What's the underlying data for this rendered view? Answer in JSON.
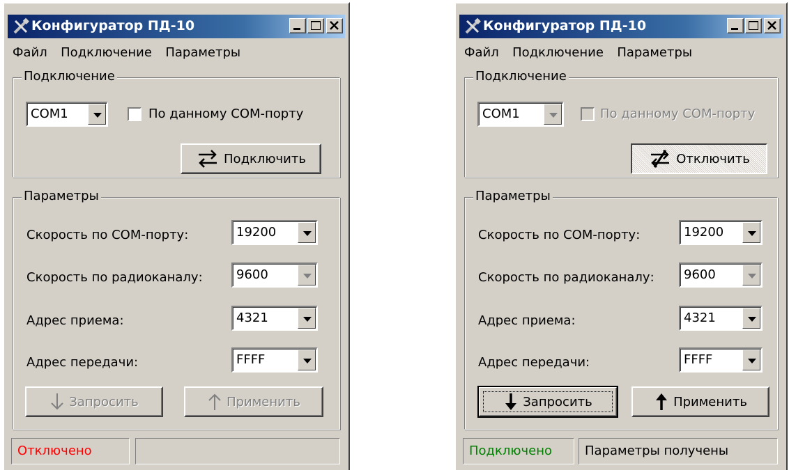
{
  "windows": [
    {
      "title": "Конфигуратор ПД-10",
      "menu": [
        "Файл",
        "Подключение",
        "Параметры"
      ],
      "connection": {
        "group_label": "Подключение",
        "port_value": "COM1",
        "checkbox_label": "По данному COM-порту",
        "button_label": "Подключить"
      },
      "params": {
        "group_label": "Параметры",
        "rows": [
          {
            "label": "Скорость по COM-порту:",
            "value": "19200"
          },
          {
            "label": "Скорость по радиоканалу:",
            "value": "9600"
          },
          {
            "label": "Адрес приема:",
            "value": "4321"
          },
          {
            "label": "Адрес передачи:",
            "value": "FFFF"
          }
        ],
        "request_label": "Запросить",
        "apply_label": "Применить"
      },
      "status": {
        "state": "Отключено",
        "message": "",
        "state_color": "#ff0000"
      }
    },
    {
      "title": "Конфигуратор ПД-10",
      "menu": [
        "Файл",
        "Подключение",
        "Параметры"
      ],
      "connection": {
        "group_label": "Подключение",
        "port_value": "COM1",
        "checkbox_label": "По данному COM-порту",
        "button_label": "Отключить"
      },
      "params": {
        "group_label": "Параметры",
        "rows": [
          {
            "label": "Скорость по COM-порту:",
            "value": "19200"
          },
          {
            "label": "Скорость по радиоканалу:",
            "value": "9600"
          },
          {
            "label": "Адрес приема:",
            "value": "4321"
          },
          {
            "label": "Адрес передачи:",
            "value": "FFFF"
          }
        ],
        "request_label": "Запросить",
        "apply_label": "Применить"
      },
      "status": {
        "state": "Подключено",
        "message": "Параметры получены",
        "state_color": "#008000"
      }
    }
  ]
}
